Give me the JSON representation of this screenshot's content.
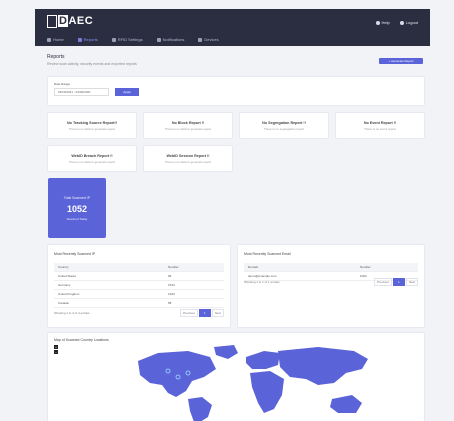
{
  "app": {
    "logo_text_prefix": "D",
    "logo_text_suffix": "AEC",
    "brand_color": "#5b63d8",
    "top_actions": [
      {
        "label": "Help",
        "icon": "help-icon"
      },
      {
        "label": "Logout",
        "icon": "logout-icon"
      }
    ],
    "nav": [
      {
        "label": "Home",
        "icon": "home-icon"
      },
      {
        "label": "Reports",
        "icon": "report-icon"
      },
      {
        "label": "RFID Settings",
        "icon": "settings-icon"
      },
      {
        "label": "Notifications",
        "icon": "bell-icon"
      },
      {
        "label": "Devices",
        "icon": "device-icon"
      }
    ]
  },
  "page": {
    "breadcrumb": "Reports",
    "subtitle": "Review scan activity, security events and exported reports",
    "action_label": "+ Generate Report",
    "date_range_label": "Date Range",
    "date_range_value": "03/29/2021 - 04/30/2021",
    "date_button": "Apply"
  },
  "reports": [
    {
      "title": "No Tracking Source Report!!",
      "sub": "There is no data to generate report"
    },
    {
      "title": "No Block Report !!",
      "sub": "There is no data to generate report"
    },
    {
      "title": "No Segregation Report !!",
      "sub": "There is no segregation report"
    },
    {
      "title": "No Event Report !!",
      "sub": "There is no event report"
    },
    {
      "title": "WebID Breach Report !!",
      "sub": "There is no data to generate report"
    },
    {
      "title": "WebID Session Report !!",
      "sub": "There is no data to generate report"
    }
  ],
  "stat": {
    "title": "Total Scanned IP",
    "value": "1052",
    "sub": "Scanned Today"
  },
  "tables": [
    {
      "title": "Most Recently Scanned IP",
      "columns": [
        "Country",
        "Number"
      ],
      "rows": [
        [
          "United States",
          "96"
        ],
        [
          "Germany",
          "1534"
        ],
        [
          "United Kingdom",
          "1203"
        ],
        [
          "Canada",
          "58"
        ]
      ],
      "footer": "Showing 1 to 4 of 4 entries",
      "pager": [
        "Previous",
        "1",
        "Next"
      ]
    },
    {
      "title": "Most Recently Scanned Email",
      "columns": [
        "Domain",
        "Number"
      ],
      "rows": [
        [
          "demo@example.com",
          "1062"
        ]
      ],
      "footer": "Showing 1 to 1 of 1 entries",
      "pager": [
        "Previous",
        "1",
        "Next"
      ]
    }
  ],
  "map": {
    "title": "Map of Scanned Country Locations",
    "zoom_in": "+",
    "zoom_out": "−",
    "land_color": "#5b63d8"
  }
}
